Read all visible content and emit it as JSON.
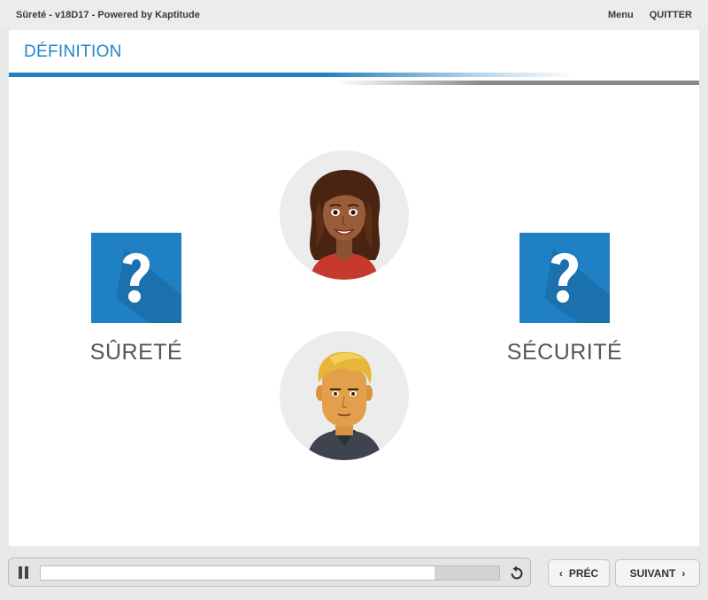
{
  "window": {
    "title": "Sûreté - v18D17 - Powered by Kaptitude"
  },
  "top_menu": {
    "menu_label": "Menu",
    "quit_label": "QUITTER"
  },
  "slide": {
    "title": "DÉFINITION",
    "left_term": "SÛRETÉ",
    "right_term": "SÉCURITÉ",
    "question_icon": "question-mark-icon",
    "avatars": [
      "woman-avatar",
      "man-avatar"
    ]
  },
  "player": {
    "progress": 0.86,
    "pause_icon": "pause-icon",
    "replay_icon": "replay-icon"
  },
  "navigation": {
    "prev_label": "PRÉC",
    "next_label": "SUIVANT",
    "prev_icon": "chevron-left-icon",
    "next_icon": "chevron-right-icon"
  },
  "colors": {
    "accent": "#1f86c8",
    "card_blue": "#1f80c4",
    "label_grey": "#555555"
  }
}
